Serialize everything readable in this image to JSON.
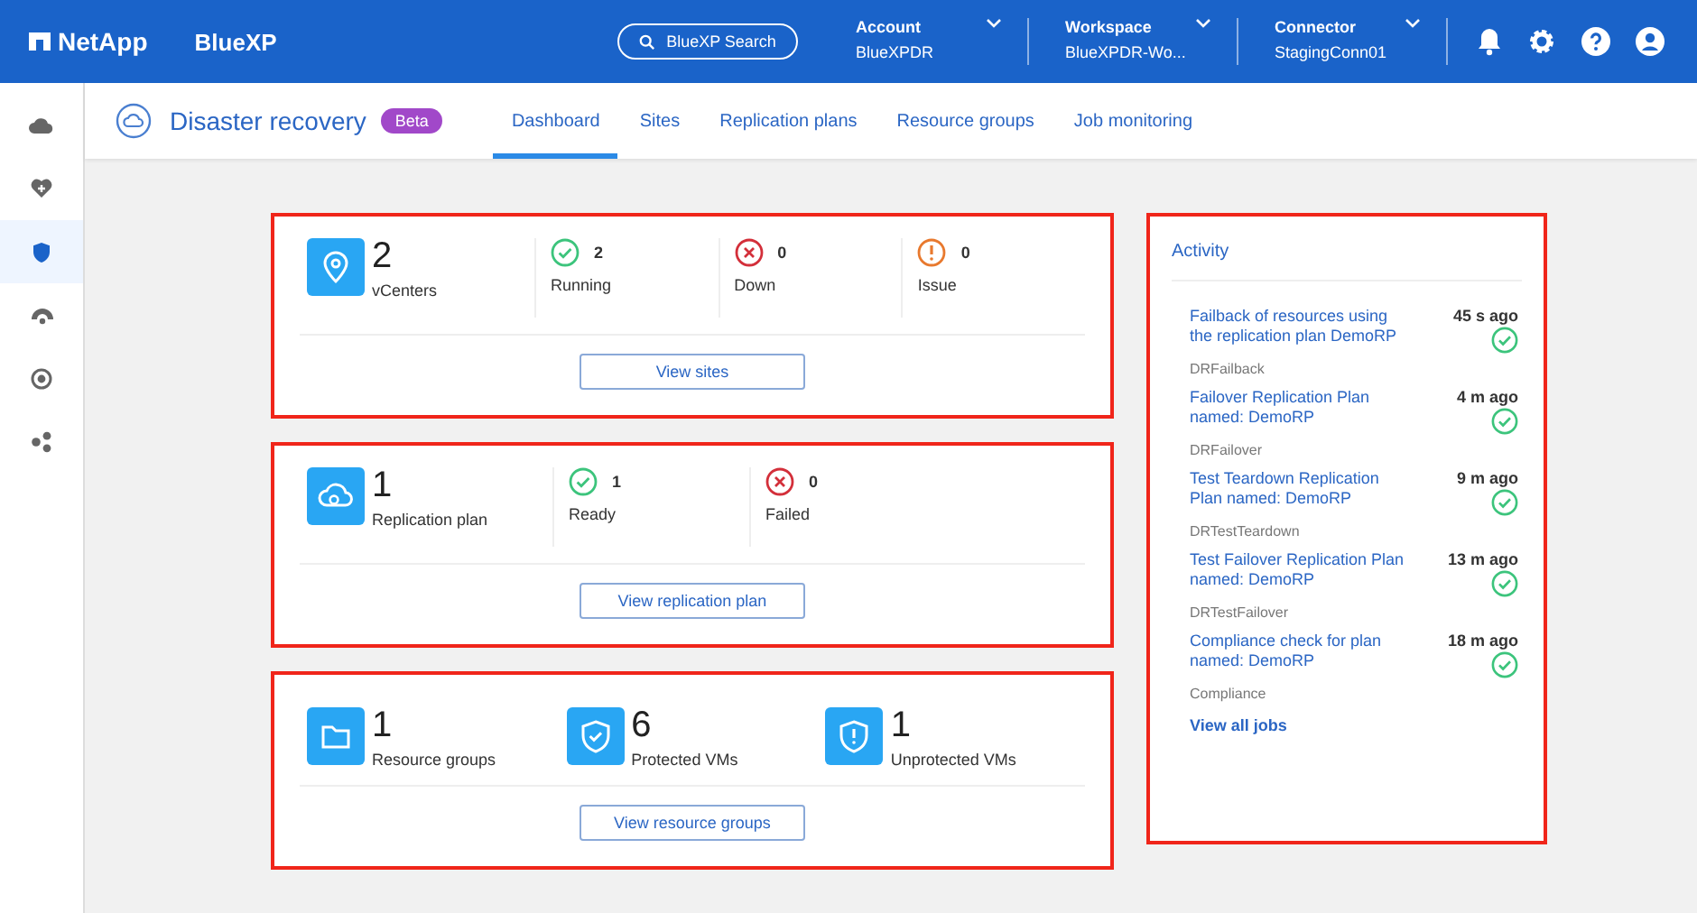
{
  "header": {
    "logo": "NetApp",
    "product": "BlueXP",
    "search": "BlueXP Search",
    "selectors": [
      {
        "label": "Account",
        "value": "BlueXPDR"
      },
      {
        "label": "Workspace",
        "value": "BlueXPDR-Wo..."
      },
      {
        "label": "Connector",
        "value": "StagingConn01"
      }
    ]
  },
  "sidebar": {
    "items": [
      {
        "kind": "cloud",
        "selected": false
      },
      {
        "kind": "heart",
        "selected": false
      },
      {
        "kind": "shield",
        "selected": true
      },
      {
        "kind": "gauge",
        "selected": false
      },
      {
        "kind": "target",
        "selected": false
      },
      {
        "kind": "nodes",
        "selected": false
      }
    ]
  },
  "page": {
    "title": "Disaster recovery",
    "badge": "Beta",
    "tabs": [
      {
        "label": "Dashboard",
        "selected": true
      },
      {
        "label": "Sites",
        "selected": false
      },
      {
        "label": "Replication plans",
        "selected": false
      },
      {
        "label": "Resource groups",
        "selected": false
      },
      {
        "label": "Job monitoring",
        "selected": false
      }
    ]
  },
  "cards": [
    {
      "kind": "status",
      "metric": {
        "kind": "pin",
        "value": "2",
        "label": "vCenters"
      },
      "stats": [
        {
          "kind": "ok",
          "value": "2",
          "label": "Running"
        },
        {
          "kind": "error",
          "value": "0",
          "label": "Down"
        },
        {
          "kind": "warning",
          "value": "0",
          "label": "Issue"
        }
      ],
      "button": "View sites"
    },
    {
      "kind": "status",
      "metric": {
        "kind": "cloud",
        "value": "1",
        "label": "Replication plan"
      },
      "stats": [
        {
          "kind": "ok",
          "value": "1",
          "label": "Ready"
        },
        {
          "kind": "error",
          "value": "0",
          "label": "Failed"
        }
      ],
      "button": "View replication plan"
    },
    {
      "kind": "metrics",
      "metrics": [
        {
          "kind": "folder",
          "value": "1",
          "label": "Resource groups"
        },
        {
          "kind": "protected",
          "value": "6",
          "label": "Protected VMs"
        },
        {
          "kind": "unprotected",
          "value": "1",
          "label": "Unprotected VMs"
        }
      ],
      "button": "View resource groups"
    }
  ],
  "activity": {
    "title": "Activity",
    "items": [
      {
        "title": "Failback of resources using the replication plan DemoRP",
        "time": "45 s ago",
        "type": "DRFailback",
        "kind": "ok"
      },
      {
        "title": "Failover Replication Plan named: DemoRP",
        "time": "4 m ago",
        "type": "DRFailover",
        "kind": "ok"
      },
      {
        "title": "Test Teardown Replication Plan named: DemoRP",
        "time": "9 m ago",
        "type": "DRTestTeardown",
        "kind": "ok"
      },
      {
        "title": "Test Failover Replication Plan named: DemoRP",
        "time": "13 m ago",
        "type": "DRTestFailover",
        "kind": "ok"
      },
      {
        "title": "Compliance check for plan named: DemoRP",
        "time": "18 m ago",
        "type": "Compliance",
        "kind": "ok"
      }
    ],
    "link": "View all jobs"
  }
}
